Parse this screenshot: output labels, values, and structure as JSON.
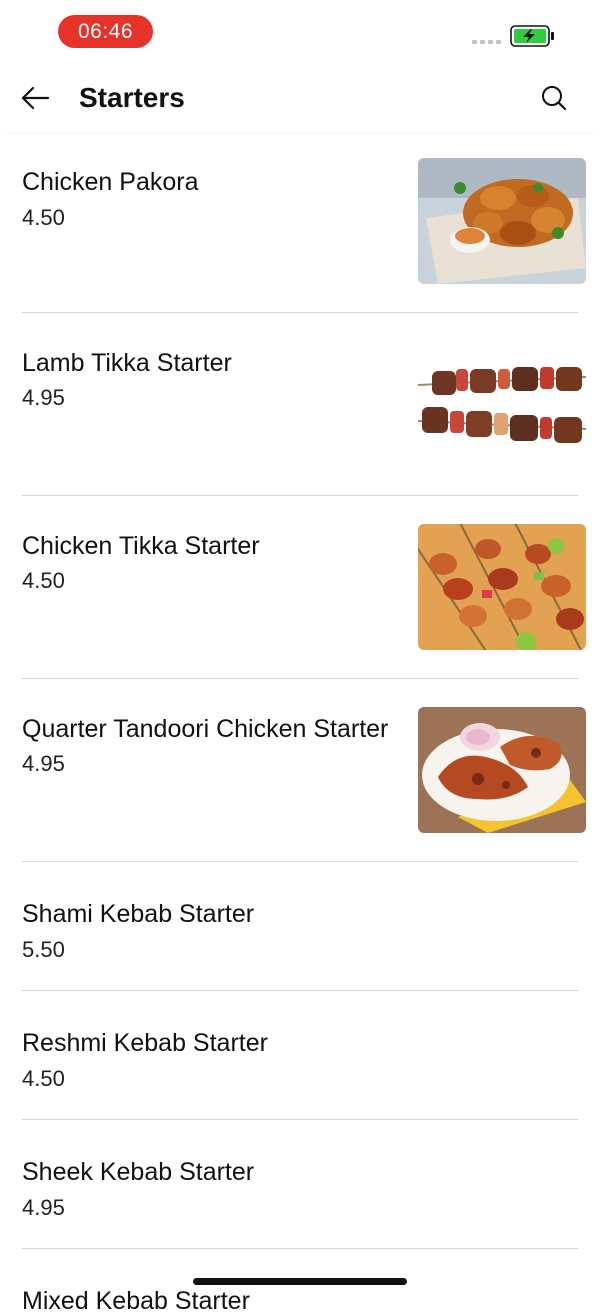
{
  "status_bar": {
    "time": "06:46",
    "time_pill_color": "#e5332a",
    "battery_icon": "battery-charging-icon",
    "battery_color": "#2ecc40"
  },
  "header": {
    "back_icon": "arrow-left-icon",
    "title": "Starters",
    "search_icon": "search-icon"
  },
  "menu_items": [
    {
      "name": "Chicken Pakora",
      "price": "4.50",
      "image": "chicken-pakora-photo"
    },
    {
      "name": "Lamb Tikka Starter",
      "price": "4.95",
      "image": "lamb-tikka-skewers-photo"
    },
    {
      "name": "Chicken Tikka Starter",
      "price": "4.50",
      "image": "chicken-tikka-skewers-photo"
    },
    {
      "name": "Quarter Tandoori Chicken Starter",
      "price": "4.95",
      "image": "tandoori-chicken-photo"
    },
    {
      "name": "Shami Kebab Starter",
      "price": "5.50"
    },
    {
      "name": "Reshmi Kebab Starter",
      "price": "4.50"
    },
    {
      "name": "Sheek Kebab Starter",
      "price": "4.95"
    },
    {
      "name": "Mixed Kebab Starter",
      "price": ""
    }
  ]
}
